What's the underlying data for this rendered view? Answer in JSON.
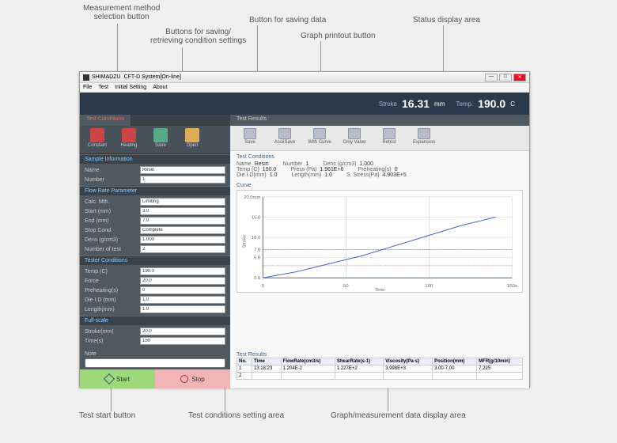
{
  "callouts": {
    "measurement_method": "Measurement method\nselection button",
    "save_retrieve": "Buttons for saving/\nretrieving condition settings",
    "save_data": "Button for saving data",
    "graph_print": "Graph printout button",
    "status_area": "Status display area",
    "test_start": "Test start button",
    "conditions_area": "Test conditions setting area",
    "graph_area": "Graph/measurement data display area"
  },
  "titlebar": {
    "brand": "SHIMADZU",
    "title": "CFT-D System[On-line]"
  },
  "menubar": [
    "File",
    "Test",
    "Initial Setting",
    "About"
  ],
  "status": {
    "stroke_label": "Stroke",
    "stroke_val": "16.31",
    "stroke_unit": "mm",
    "temp_label": "Temp.",
    "temp_val": "190.0",
    "temp_unit": "C"
  },
  "sidebar": {
    "tab": "Test Conditions",
    "tools": [
      {
        "label": "Constant"
      },
      {
        "label": "Heating"
      },
      {
        "label": "Save"
      },
      {
        "label": "Open"
      }
    ],
    "sample_hdr": "Sample Information",
    "sample": {
      "name_lbl": "Name",
      "name_val": "Resin",
      "num_lbl": "Number",
      "num_val": "1"
    },
    "flow_hdr": "Flow Rate Parameter",
    "flow": {
      "calc_lbl": "Calc. Mth.",
      "calc_val": "Limiting",
      "start_lbl": "Start (mm)",
      "start_val": "3.0",
      "end_lbl": "End (mm)",
      "end_val": "7.0",
      "stop_lbl": "Stop Cond.",
      "stop_val": "Complete",
      "dens_lbl": "Dens (g/cm3)",
      "dens_val": "1.000",
      "nt_lbl": "Number of test",
      "nt_val": "2"
    },
    "tester_hdr": "Tester Conditions",
    "tester": {
      "temp_lbl": "Temp (C)",
      "temp_val": "190.0",
      "force_lbl": "Force",
      "force_val": "20.0",
      "pre_lbl": "Preheating(s)",
      "pre_val": "0",
      "did_lbl": "Die I.D (mm)",
      "did_val": "1.0",
      "len_lbl": "Length(mm)",
      "len_val": "1.0"
    },
    "full_hdr": "Full-scale",
    "full": {
      "str_lbl": "Stroke(mm)",
      "str_val": "20.0",
      "time_lbl": "Time(s)",
      "time_val": "150"
    },
    "note_lbl": "Note",
    "start_btn": "Start",
    "stop_btn": "Stop"
  },
  "main": {
    "tab": "Test Results",
    "tools": [
      {
        "label": "Save"
      },
      {
        "label": "AsciiSave"
      },
      {
        "label": "With Curve"
      },
      {
        "label": "Only Value"
      },
      {
        "label": "Retest"
      },
      {
        "label": "Expansion"
      }
    ],
    "cond_title": "Test Conditions",
    "cond": {
      "r1": [
        [
          "Name",
          "Resin"
        ],
        [
          "Number",
          "1"
        ],
        [
          "Dens (g/cm3)",
          "1.000"
        ]
      ],
      "r2": [
        [
          "Temp (C)",
          "190.0"
        ],
        [
          "Press (Pa)",
          "1.961E+6"
        ],
        [
          "Preheating(s)",
          "0"
        ]
      ],
      "r3": [
        [
          "Die I.D(mm)",
          "1.0"
        ],
        [
          "Length(mm)",
          "1.0"
        ],
        [
          "S. Stress(Pa)",
          "4.903E+5"
        ]
      ]
    },
    "curve_title": "Curve",
    "results_title": "Test Results",
    "rtable": {
      "headers": [
        "No.",
        "Time",
        "FlowRate(cm3/s)",
        "ShearRate(s-1)",
        "Viscosity(Pa·s)",
        "Position(mm)",
        "MFR(g/10min)"
      ],
      "rows": [
        [
          "1",
          "13:18:23",
          "1.204E-2",
          "1.227E+2",
          "3.998E+3",
          "3.00-7.00",
          "7.225"
        ],
        [
          "2",
          "",
          "",
          "",
          "",
          "",
          ""
        ]
      ]
    }
  },
  "chart_data": {
    "type": "line",
    "xlabel": "Time",
    "ylabel": "Stroke",
    "xlim": [
      0,
      150
    ],
    "ylim": [
      0,
      20
    ],
    "xticks": [
      0,
      50,
      100,
      150
    ],
    "yticks": [
      0,
      5,
      7,
      10,
      15,
      20
    ],
    "hlines": [
      3.0,
      7.0
    ],
    "series": [
      {
        "name": "stroke",
        "x": [
          0,
          20,
          40,
          60,
          80,
          100,
          120,
          140
        ],
        "y": [
          0,
          1.5,
          3.5,
          5.5,
          8,
          10.5,
          13,
          15
        ]
      }
    ]
  }
}
